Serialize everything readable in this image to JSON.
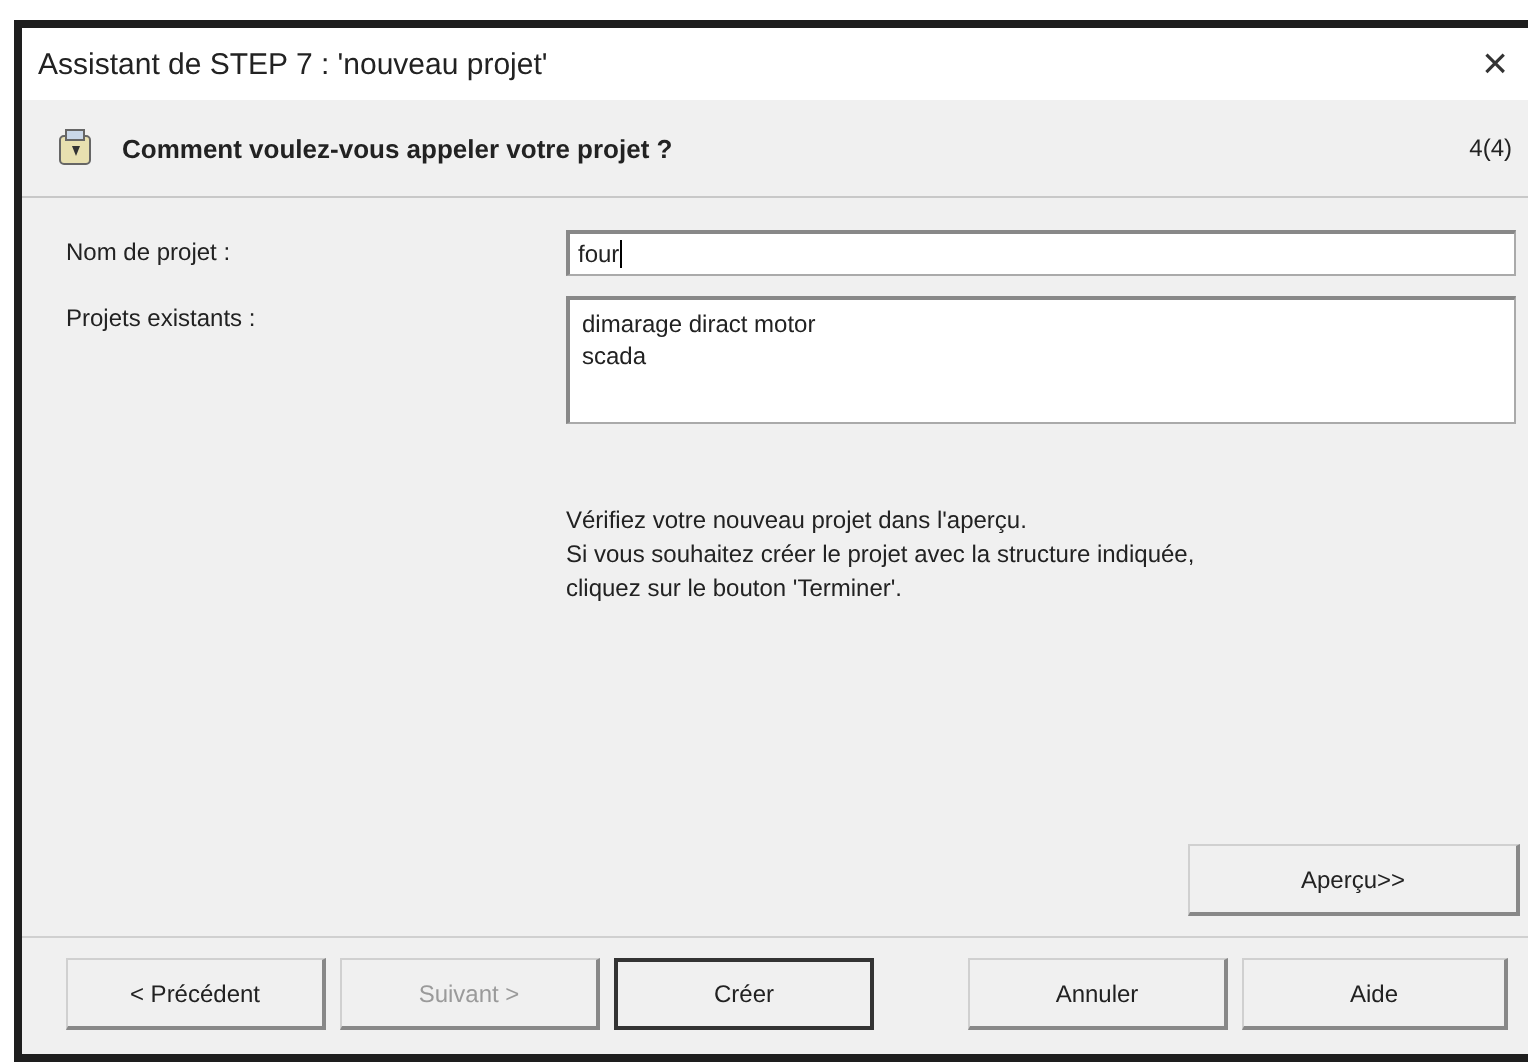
{
  "window": {
    "title": "Assistant de STEP 7 : 'nouveau projet'",
    "close": "×"
  },
  "header": {
    "question": "Comment voulez-vous appeler votre projet ?",
    "step": "4(4)"
  },
  "project_name": {
    "label": "Nom de projet :",
    "value": "four"
  },
  "existing_projects": {
    "label": "Projets existants :",
    "items": [
      "dimarage diract motor",
      "scada"
    ]
  },
  "info": [
    "Vérifiez votre nouveau projet dans l'aperçu.",
    "Si vous souhaitez créer le projet avec la structure  indiquée,",
    "cliquez sur le bouton 'Terminer'."
  ],
  "preview_button": {
    "label": "Aperçu>>"
  },
  "buttons": [
    {
      "label": "< Précédent",
      "disabled": false,
      "default": false
    },
    {
      "label": "Suivant >",
      "disabled": true,
      "default": false
    },
    {
      "label": "Créer",
      "disabled": false,
      "default": true
    },
    {
      "label": "Annuler",
      "disabled": false,
      "default": false
    },
    {
      "label": "Aide",
      "disabled": false,
      "default": false
    }
  ]
}
